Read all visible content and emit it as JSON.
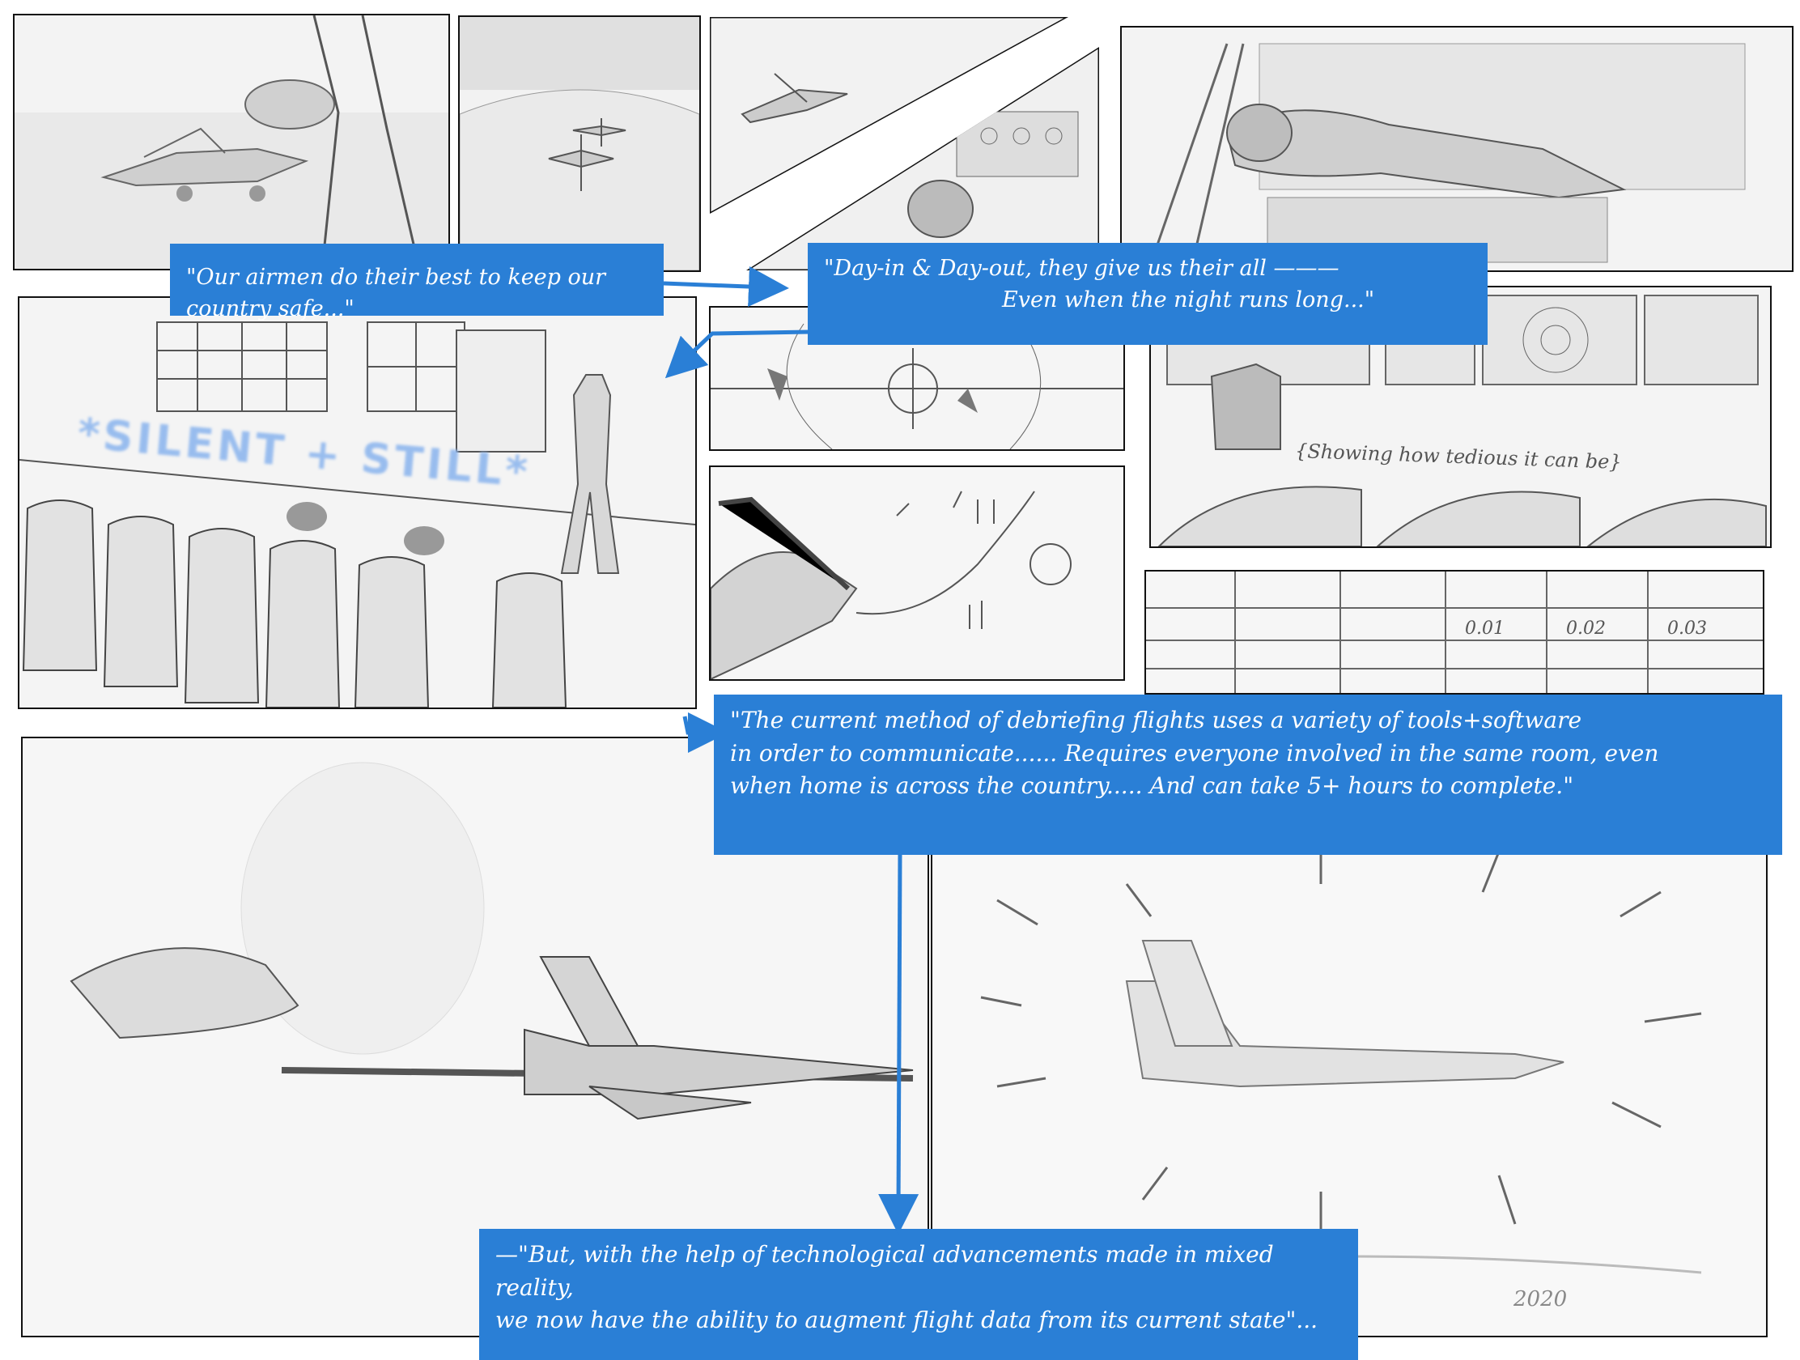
{
  "captions": {
    "c1": "\"Our airmen do their best to keep our country safe...\"",
    "c2_line1": "\"Day-in & Day-out, they give us their all ———",
    "c2_line2": "Even when the night runs long...\"",
    "c3_line1": "\"The current method of debriefing flights uses a variety of tools+software",
    "c3_line2": "in order to communicate...... Requires everyone involved in the same room, even",
    "c3_line3": "when home is across the country..... And can take 5+ hours to complete.\"",
    "c4_line1": "—\"But, with the help of technological advancements made in mixed reality,",
    "c4_line2": "we now have the ability to augment flight data from its current state\"..."
  },
  "annotations": {
    "silent": "*SILENT + STILL*",
    "tedious": "{Showing how tedious it can be}",
    "table_values": [
      "0.01",
      "0.02",
      "0.03"
    ],
    "signature_year": "2020"
  },
  "colors": {
    "caption_bg": "#2a7fd6",
    "arrow": "#2a7fd6",
    "sketch": "#777777"
  },
  "icons": [
    "jet-sketch",
    "pilot-sketch",
    "radar-sketch",
    "hand-pen-sketch",
    "chair-sketch"
  ]
}
